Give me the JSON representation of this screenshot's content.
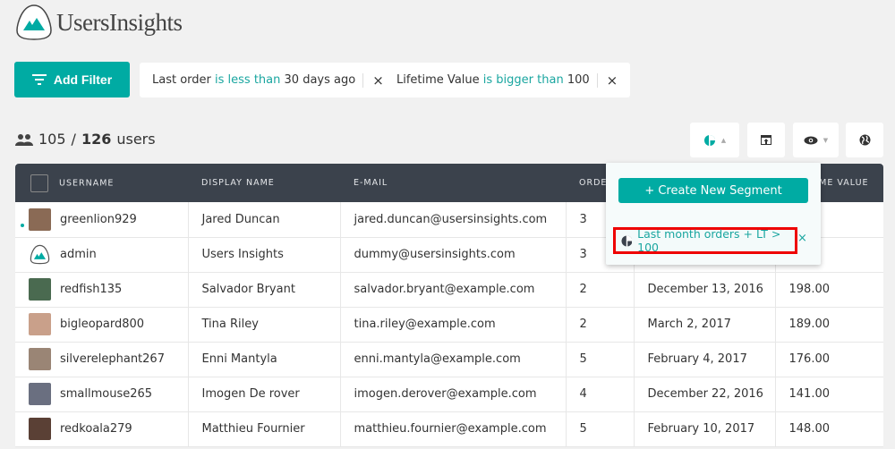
{
  "app": {
    "name": "UsersInsights"
  },
  "toolbar": {
    "add_filter": "Add Filter"
  },
  "filters": [
    {
      "field": "Last order",
      "op": "is less than",
      "value": "30 days ago"
    },
    {
      "field": "Lifetime Value",
      "op": "is bigger than",
      "value": "100"
    }
  ],
  "count": {
    "shown": "105",
    "separator": "/",
    "total": "126",
    "unit": "users"
  },
  "table": {
    "headers": [
      "USERNAME",
      "DISPLAY NAME",
      "E-MAIL",
      "ORDERS",
      "",
      "LIFETIME VALUE"
    ],
    "rows": [
      {
        "username": "greenlion929",
        "display": "Jared Duncan",
        "email": "jared.duncan@usersinsights.com",
        "orders": "3",
        "last": "",
        "value": "",
        "avatar": "#8a6a55",
        "online": true
      },
      {
        "username": "admin",
        "display": "Users Insights",
        "email": "dummy@usersinsights.com",
        "orders": "3",
        "last": "",
        "value": "",
        "avatar": "logo"
      },
      {
        "username": "redfish135",
        "display": "Salvador Bryant",
        "email": "salvador.bryant@example.com",
        "orders": "2",
        "last": "December 13, 2016",
        "value": "198.00",
        "avatar": "#4a6a50"
      },
      {
        "username": "bigleopard800",
        "display": "Tina Riley",
        "email": "tina.riley@example.com",
        "orders": "2",
        "last": "March 2, 2017",
        "value": "189.00",
        "avatar": "#c9a08a"
      },
      {
        "username": "silverelephant267",
        "display": "Enni Mantyla",
        "email": "enni.mantyla@example.com",
        "orders": "5",
        "last": "February 4, 2017",
        "value": "176.00",
        "avatar": "#9a8575"
      },
      {
        "username": "smallmouse265",
        "display": "Imogen De rover",
        "email": "imogen.derover@example.com",
        "orders": "4",
        "last": "December 22, 2016",
        "value": "141.00",
        "avatar": "#6a6f80"
      },
      {
        "username": "redkoala279",
        "display": "Matthieu Fournier",
        "email": "matthieu.fournier@example.com",
        "orders": "5",
        "last": "February 10, 2017",
        "value": "148.00",
        "avatar": "#5a4035"
      }
    ]
  },
  "segments": {
    "create": "+ Create New Segment",
    "items": [
      {
        "name": "Last month orders + LT > 100"
      }
    ]
  },
  "colors": {
    "accent": "#00aba3",
    "header": "#3b424c",
    "highlight": "#ee0000"
  }
}
